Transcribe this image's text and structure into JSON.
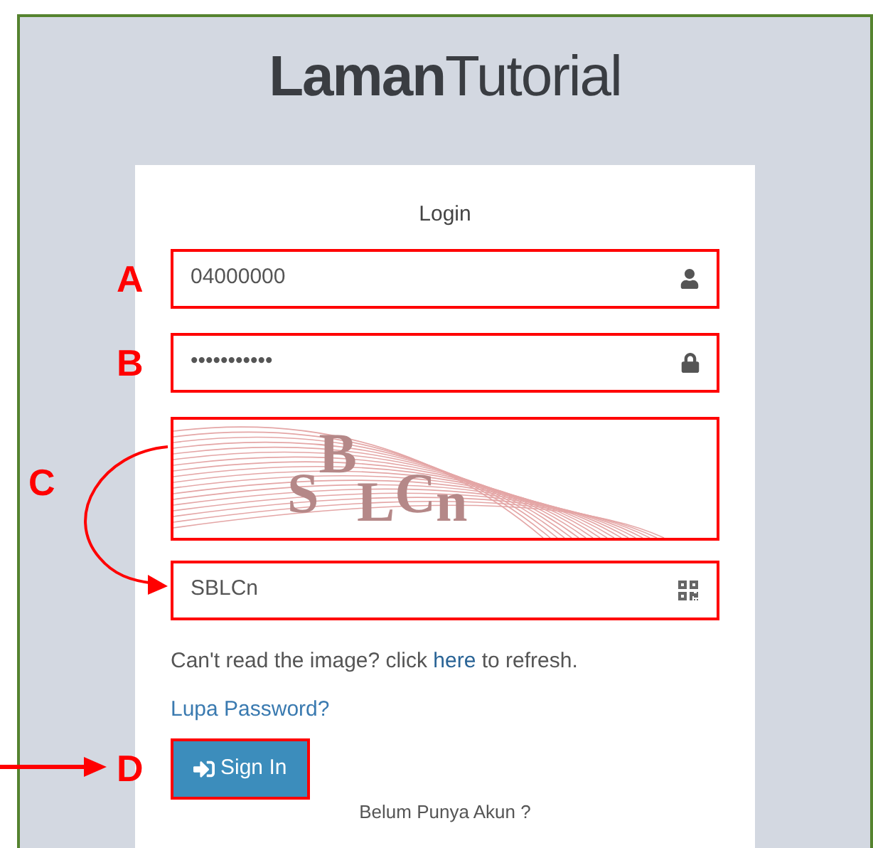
{
  "brand": {
    "bold": "Laman",
    "regular": "Tutorial"
  },
  "form": {
    "title": "Login",
    "fields": [
      {
        "kind": "username",
        "value": "04000000",
        "annotation": "A"
      },
      {
        "kind": "password",
        "value": "•••••••••••",
        "annotation": "B"
      }
    ],
    "captcha": {
      "text": "SBLCn",
      "annotation": "C",
      "input_value": "SBLCn"
    },
    "refresh_note": {
      "before": "Can't read the image? click",
      "link": "here",
      "after": "to refresh."
    },
    "forgot_link": "Lupa Password?",
    "submit": {
      "label": "Sign In",
      "annotation": "D"
    },
    "footer_text": "Belum Punya Akun ?"
  }
}
